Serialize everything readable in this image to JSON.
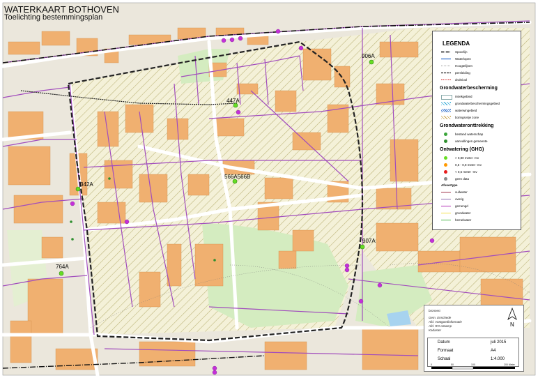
{
  "title": "WATERKAART BOTHOVEN",
  "subtitle": "Toelichting bestemmingsplan",
  "map_labels": [
    {
      "text": "906A"
    },
    {
      "text": "447A"
    },
    {
      "text": "566A566B"
    },
    {
      "text": "342A"
    },
    {
      "text": "907A"
    },
    {
      "text": "764A"
    }
  ],
  "legend": {
    "title": "LEGENDA",
    "base_items": [
      {
        "label": "Spoorlijn"
      },
      {
        "label": "Waterlopen"
      },
      {
        "label": "Hoogtelijnen"
      },
      {
        "label": "persleiding"
      },
      {
        "label": "drukriool"
      }
    ],
    "grondwaterbescherming": {
      "heading": "Grondwaterbescherming",
      "items": [
        "intrekgebied",
        "grondwaterbeschermingsgebied",
        "waterwingebied",
        "boringsvrije zone"
      ]
    },
    "grondwateronttrekking": {
      "heading": "Grondwateronttrekking",
      "items": [
        {
          "label": "bestand waterschap",
          "color": "#3aa53a"
        },
        {
          "label": "aanvullingen gemeente",
          "color": "#2f8f2f"
        }
      ]
    },
    "ontwatering": {
      "heading": "Ontwatering (GHG)",
      "items": [
        {
          "label": "> 0,80 meter -mv",
          "color": "#66dd22"
        },
        {
          "label": "0,5 - 0,8 meter -mv",
          "color": "#ff9900"
        },
        {
          "label": "< 0,5 meter -mv",
          "color": "#e81c1c"
        },
        {
          "label": "geen data",
          "color": "#8a8a8a"
        }
      ]
    },
    "afvoertype": {
      "heading": "Afvoertype",
      "items": [
        {
          "label": "vuilwater",
          "color": "#a0334a"
        },
        {
          "label": "overig",
          "color": "#8c6ab0"
        },
        {
          "label": "gemengd",
          "color": "#b12fb5"
        },
        {
          "label": "grondwater",
          "color": "#f5e04a"
        },
        {
          "label": "hemelwater",
          "color": "#4ab84a"
        }
      ]
    }
  },
  "info_box": {
    "sources_heading": "bronnen:",
    "sources": [
      "Gem. Enschede",
      "Afd. Vastgoedinformatie",
      "Afd. RO ontwerp",
      "Kadaster"
    ],
    "north_label": "N",
    "datum_key": "Datum",
    "datum_value": "juli 2015",
    "formaat_key": "Formaat",
    "formaat_value": "A4",
    "schaal_key": "Schaal",
    "schaal_value": "1:4.000",
    "scale_ticks": [
      "0",
      "50",
      "100",
      "200 Meter"
    ]
  },
  "colors": {
    "building": "#f0b070",
    "road": "#ffffff",
    "sewer_mixed": "#b12fb5",
    "sewer_other": "#8c6ab0",
    "green": "#d4ecc0",
    "railway": "#000000",
    "boundary": "#222222"
  }
}
